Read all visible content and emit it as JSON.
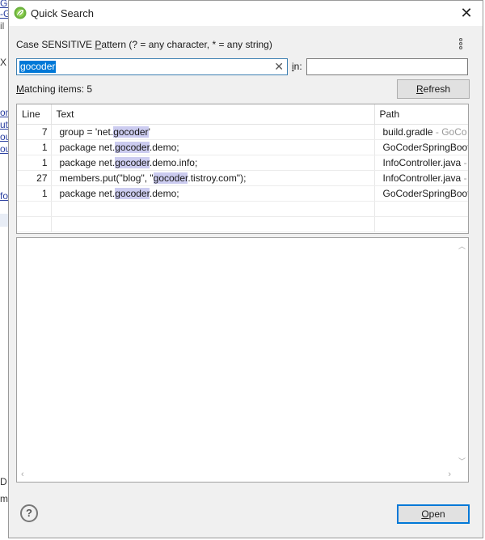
{
  "dialog": {
    "title": "Quick Search",
    "pattern_label_pre": "Case SENSITIVE ",
    "pattern_label_mnemonic": "P",
    "pattern_label_post": "attern (? = any character, * = any string)",
    "search_value": "gocoder",
    "in_label_mnemonic": "i",
    "in_label_post": "n:",
    "in_value": "",
    "matching_mnemonic": "M",
    "matching_label": "atching items: 5",
    "refresh_mnemonic": "R",
    "refresh_label": "efresh",
    "open_mnemonic": "O",
    "open_label": "pen"
  },
  "results": {
    "columns": [
      "Line",
      "Text",
      "Path"
    ],
    "rows": [
      {
        "line": "7",
        "pre": "group = 'net.",
        "match": "gocoder",
        "post": "'",
        "path": "build.gradle",
        "path_suffix": " - GoCo"
      },
      {
        "line": "1",
        "pre": "package net.",
        "match": "gocoder",
        "post": ".demo;",
        "path": "GoCoderSpringBoot",
        "path_suffix": ""
      },
      {
        "line": "1",
        "pre": "package net.",
        "match": "gocoder",
        "post": ".demo.info;",
        "path": "InfoController.java",
        "path_suffix": " -"
      },
      {
        "line": "27",
        "pre": "members.put(\"blog\", \"",
        "match": "gocoder",
        "post": ".tistroy.com\");",
        "path": "InfoController.java",
        "path_suffix": " -"
      },
      {
        "line": "1",
        "pre": "package net.",
        "match": "gocoder",
        "post": ".demo;",
        "path": "GoCoderSpringBoot",
        "path_suffix": ""
      }
    ]
  },
  "background": {
    "fragments": [
      "Go",
      "-G",
      "il",
      "X",
      "on",
      "ut",
      "ou",
      "ou",
      "fo",
      "D",
      "m"
    ]
  },
  "colors": {
    "match_highlight": "#ccccf0",
    "selection": "#0078d7",
    "default_button_border": "#0078d7"
  },
  "icons": {
    "app": "spring-leaf-icon",
    "close": "close-icon",
    "clear": "clear-x-icon",
    "menu": "vertical-dots-menu-icon",
    "help": "help-question-icon"
  }
}
